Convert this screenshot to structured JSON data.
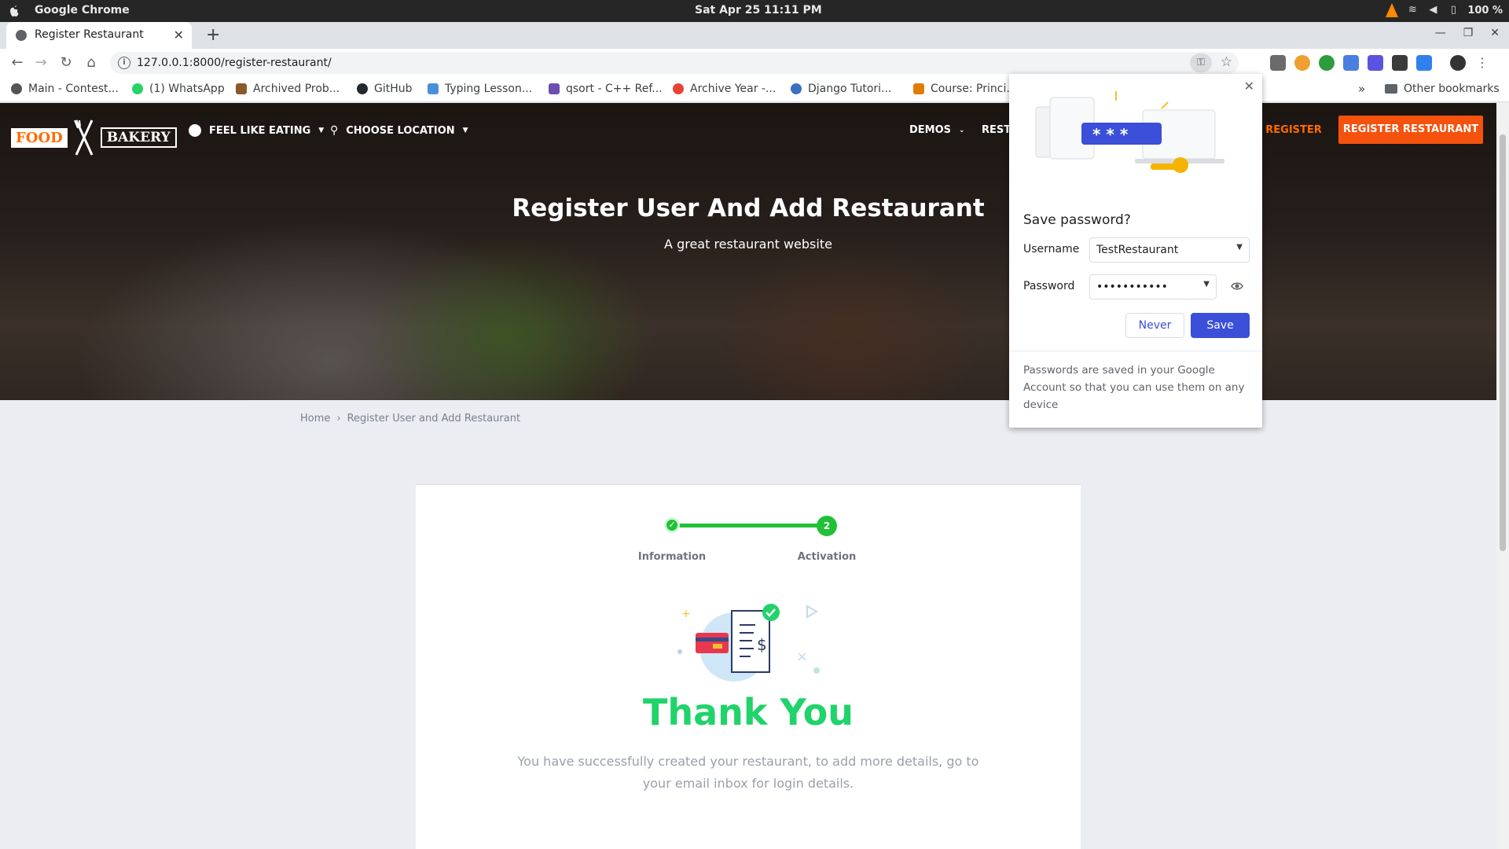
{
  "os": {
    "app_name": "Google Chrome",
    "clock": "Sat Apr 25  11:11 PM",
    "battery": "100 %"
  },
  "browser": {
    "tab_title": "Register Restaurant",
    "new_tab": "+",
    "url": "127.0.0.1:8000/register-restaurant/",
    "bookmarks": [
      {
        "label": "Main - Contest..."
      },
      {
        "label": "(1) WhatsApp"
      },
      {
        "label": "Archived Prob..."
      },
      {
        "label": "GitHub"
      },
      {
        "label": "Typing Lesson..."
      },
      {
        "label": "qsort - C++ Ref..."
      },
      {
        "label": "Archive Year -..."
      },
      {
        "label": "Django Tutori..."
      },
      {
        "label": "Course: Princi..."
      }
    ],
    "more_bookmarks": "»",
    "other_bookmarks": "Other bookmarks"
  },
  "site": {
    "logo_food": "FOOD",
    "logo_bakery": "BAKERY",
    "nav_feel": "FEEL LIKE EATING",
    "nav_location": "CHOOSE LOCATION",
    "nav_demos": "DEMOS",
    "nav_resta": "RESTA",
    "nav_register": "/ REGISTER",
    "cta": "REGISTER RESTAURANT",
    "hero_title": "Register User And Add Restaurant",
    "hero_sub": "A great restaurant website",
    "breadcrumb_home": "Home",
    "breadcrumb_sep": "›",
    "breadcrumb_current": "Register User and Add Restaurant",
    "step1_label": "Information",
    "step2_number": "2",
    "step2_label": "Activation",
    "thanks_title": "Thank You",
    "thanks_text": "You have successfully created your restaurant, to add more details, go to your email inbox for login details."
  },
  "password_prompt": {
    "title": "Save password?",
    "username_label": "Username",
    "username_value": "TestRestaurant",
    "password_label": "Password",
    "password_value": "•••••••••••",
    "never_label": "Never",
    "save_label": "Save",
    "footer": "Passwords are saved in your Google Account so that you can use them on any device",
    "illus_stars": "* * *"
  },
  "colors": {
    "accent_orange": "#f4520d",
    "success_green": "#20c137",
    "thanks_green": "#20d36a",
    "chrome_blue": "#3b4fd8"
  }
}
